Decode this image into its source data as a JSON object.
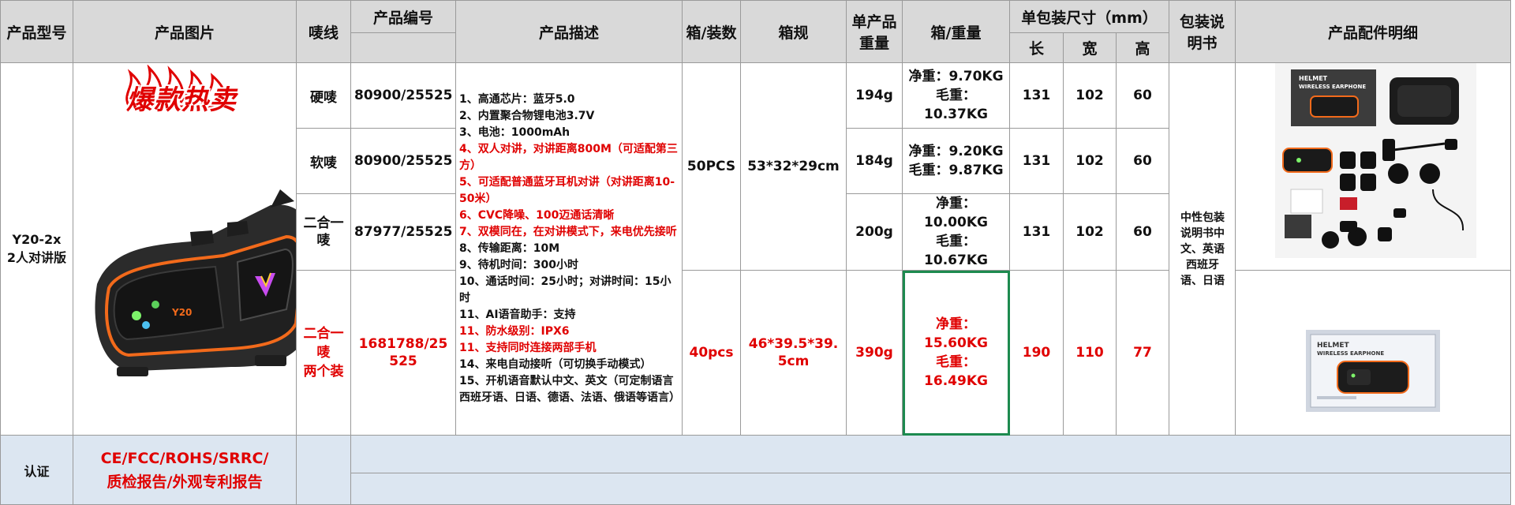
{
  "headers": {
    "model": "产品型号",
    "image": "产品图片",
    "thread": "唛线",
    "code": "产品编号",
    "desc": "产品描述",
    "per_box": "箱/装数",
    "box_spec": "箱规",
    "unit_weight": "单产品重量",
    "box_weight": "箱/重量",
    "pkg_size": "单包装尺寸（mm）",
    "len": "长",
    "wid": "宽",
    "hei": "高",
    "manual": "包装说明书",
    "accessories": "产品配件明细"
  },
  "model": "Y20-2x\n2人对讲版",
  "hot_label": "爆款热卖",
  "rows": [
    {
      "thread": "硬唛",
      "code": "80900/25525",
      "unit_weight": "194g",
      "net": "净重：9.70KG",
      "gross": "毛重：10.37KG",
      "len": "131",
      "wid": "102",
      "hei": "60"
    },
    {
      "thread": "软唛",
      "code": "80900/25525",
      "unit_weight": "184g",
      "net": "净重：9.20KG",
      "gross": "毛重：9.87KG",
      "len": "131",
      "wid": "102",
      "hei": "60"
    },
    {
      "thread": "二合一唛",
      "code": "87977/25525",
      "unit_weight": "200g",
      "net": "净重：10.00KG",
      "gross": "毛重：10.67KG",
      "len": "131",
      "wid": "102",
      "hei": "60"
    },
    {
      "thread": "二合一唛\n两个装",
      "code": "1681788/25525",
      "unit_weight": "390g",
      "net": "净重：15.60KG",
      "gross": "毛重：16.49KG",
      "len": "190",
      "wid": "110",
      "hei": "77",
      "per_box": "40pcs",
      "box_spec": "46*39.5*39.5cm"
    }
  ],
  "per_box_main": "50PCS",
  "box_spec_main": "53*32*29cm",
  "description": [
    {
      "text": "1、高通芯片：蓝牙5.0",
      "red": false
    },
    {
      "text": "2、内置聚合物锂电池3.7V",
      "red": false
    },
    {
      "text": "3、电池：1000mAh",
      "red": false
    },
    {
      "text": "4、双人对讲，对讲距离800M（可适配第三方）",
      "red": true
    },
    {
      "text": "5、可适配普通蓝牙耳机对讲（对讲距离10-50米）",
      "red": true
    },
    {
      "text": "6、CVC降噪、100迈通话清晰",
      "red": true
    },
    {
      "text": "7、双模同在，在对讲模式下，来电优先接听",
      "red": true
    },
    {
      "text": "8、传输距离：10M",
      "red": false
    },
    {
      "text": "9、待机时间：300小时",
      "red": false
    },
    {
      "text": "10、通话时间：25小时；对讲时间：15小时",
      "red": false
    },
    {
      "text": "11、AI语音助手：支持",
      "red": false
    },
    {
      "text": "11、防水级别：IPX6",
      "red": true
    },
    {
      "text": "11、支持同时连接两部手机",
      "red": true
    },
    {
      "text": "14、来电自动接听（可切换手动模式）",
      "red": false
    },
    {
      "text": "15、开机语音默认中文、英文（可定制语言西班牙语、日语、德语、法语、俄语等语言）",
      "red": false
    }
  ],
  "manual": "中性包装说明书中文、英语西班牙语、日语",
  "cert_label": "认证",
  "cert_text": "CE/FCC/ROHS/SRRC/\n质检报告/外观专利报告",
  "photo_text": {
    "brand_line1": "HELMET",
    "brand_line2": "WIRELESS EARPHONE",
    "device_logo": "Y20"
  },
  "colors": {
    "red": "#e00000",
    "header_bg": "#d9d9d9",
    "cert_bg": "#dce6f1",
    "selection": "#1d8a4f",
    "device_accent": "#f26a1b"
  }
}
